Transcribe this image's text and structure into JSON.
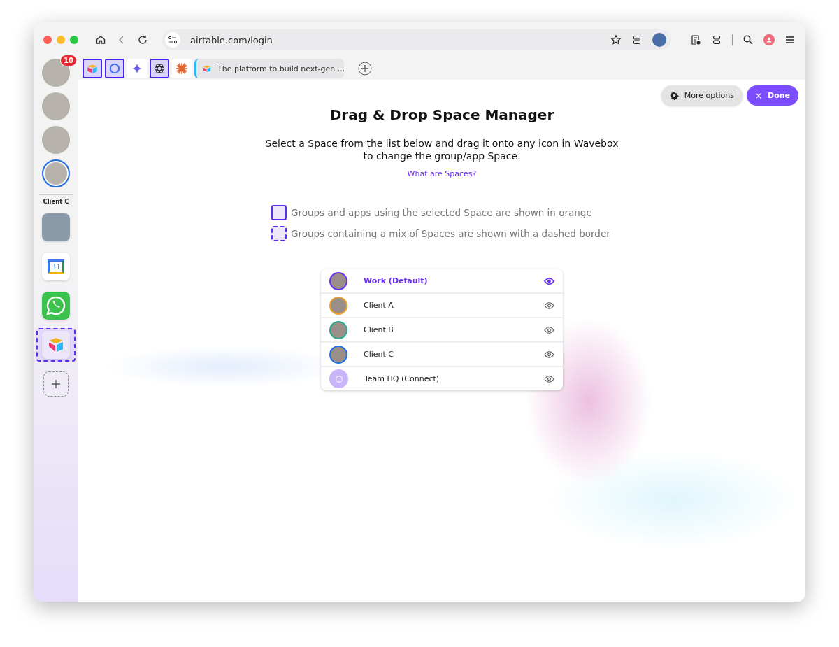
{
  "browser": {
    "address": "airtable.com/login"
  },
  "sidebar": {
    "badge": "10",
    "profiles": [
      {
        "selected": false
      },
      {
        "selected": false
      },
      {
        "selected": false
      },
      {
        "selected": true
      }
    ],
    "group_label": "Client C",
    "apps": [
      {
        "kind": "photo",
        "dashed": false
      },
      {
        "kind": "calendar",
        "label": "31",
        "dashed": false
      },
      {
        "kind": "whatsapp",
        "dashed": false
      },
      {
        "kind": "airtable",
        "dashed": true
      }
    ]
  },
  "tabs": [
    {
      "kind": "airtable",
      "highlighted": true
    },
    {
      "kind": "ring",
      "highlighted": true
    },
    {
      "kind": "sparkle",
      "highlighted": false
    },
    {
      "kind": "knot",
      "highlighted": true
    },
    {
      "kind": "burst",
      "highlighted": false
    },
    {
      "kind": "page",
      "title": "The platform to build next-gen ..."
    }
  ],
  "actions": {
    "more_options": "More options",
    "done": "Done"
  },
  "panel": {
    "title": "Drag & Drop Space Manager",
    "description": "Select a Space from the list below and drag it onto any icon in Wavebox to change the group/app Space.",
    "link": "What are Spaces?",
    "legend": [
      {
        "kind": "solid",
        "text": "Groups and apps using the selected Space are shown in orange"
      },
      {
        "kind": "dashed",
        "text": "Groups containing a mix of Spaces are shown with a dashed border"
      }
    ],
    "spaces": [
      {
        "name": "Work (Default)",
        "kind": "photo",
        "color": "#6a2ff5",
        "selected": true
      },
      {
        "name": "Client A",
        "kind": "photo",
        "color": "#f0a020",
        "selected": false
      },
      {
        "name": "Client B",
        "kind": "photo",
        "color": "#2aa88f",
        "selected": false
      },
      {
        "name": "Client C",
        "kind": "photo",
        "color": "#1f6fe8",
        "selected": false
      },
      {
        "name": "Team HQ (Connect)",
        "kind": "connect",
        "color": "#c8b4f8",
        "selected": false
      }
    ]
  }
}
